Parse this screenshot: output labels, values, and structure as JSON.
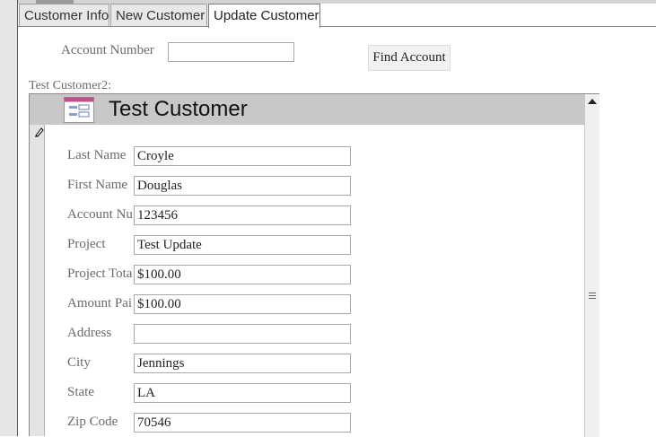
{
  "tabs": [
    {
      "label": "Customer Info",
      "active": false
    },
    {
      "label": "New Customer",
      "active": false
    },
    {
      "label": "Update Customer",
      "active": true
    }
  ],
  "search": {
    "account_label": "Account Number",
    "account_value": "",
    "find_button": "Find Account"
  },
  "subform": {
    "caption": "Test Customer2:",
    "title": "Test Customer",
    "fields": [
      {
        "label": "Last Name",
        "value": "Croyle"
      },
      {
        "label": "First Name",
        "value": "Douglas"
      },
      {
        "label": "Account Nu",
        "value": "123456"
      },
      {
        "label": "Project",
        "value": "Test Update"
      },
      {
        "label": "Project Tota",
        "value": "$100.00"
      },
      {
        "label": "Amount Pai",
        "value": "$100.00"
      },
      {
        "label": "Address",
        "value": ""
      },
      {
        "label": "City",
        "value": "Jennings"
      },
      {
        "label": "State",
        "value": "LA"
      },
      {
        "label": "Zip Code",
        "value": "70546"
      }
    ]
  },
  "icons": {
    "form_icon": "form-icon",
    "record_selector": "pencil-icon",
    "scroll_up": "arrow-up-icon",
    "scroll_grip": "scroll-grip-icon"
  }
}
